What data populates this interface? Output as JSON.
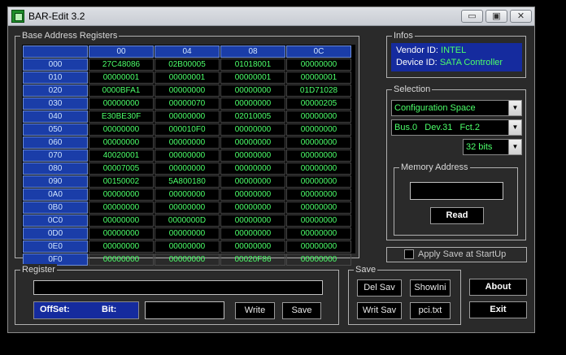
{
  "window": {
    "title": "BAR-Edit 3.2"
  },
  "titlebar": {
    "min_glyph": "▭",
    "max_glyph": "▣",
    "close_glyph": "✕"
  },
  "bar_group": {
    "label": "Base Address Registers",
    "columns": [
      "00",
      "04",
      "08",
      "0C"
    ],
    "rows": [
      {
        "addr": "000",
        "cells": [
          "27C48086",
          "02B00005",
          "01018001",
          "00000000"
        ]
      },
      {
        "addr": "010",
        "cells": [
          "00000001",
          "00000001",
          "00000001",
          "00000001"
        ]
      },
      {
        "addr": "020",
        "cells": [
          "0000BFA1",
          "00000000",
          "00000000",
          "01D71028"
        ]
      },
      {
        "addr": "030",
        "cells": [
          "00000000",
          "00000070",
          "00000000",
          "00000205"
        ]
      },
      {
        "addr": "040",
        "cells": [
          "E30BE30F",
          "00000000",
          "02010005",
          "00000000"
        ]
      },
      {
        "addr": "050",
        "cells": [
          "00000000",
          "000010F0",
          "00000000",
          "00000000"
        ]
      },
      {
        "addr": "060",
        "cells": [
          "00000000",
          "00000000",
          "00000000",
          "00000000"
        ]
      },
      {
        "addr": "070",
        "cells": [
          "40020001",
          "00000000",
          "00000000",
          "00000000"
        ]
      },
      {
        "addr": "080",
        "cells": [
          "00007005",
          "00000000",
          "00000000",
          "00000000"
        ]
      },
      {
        "addr": "090",
        "cells": [
          "00150002",
          "5A800180",
          "00000000",
          "00000000"
        ]
      },
      {
        "addr": "0A0",
        "cells": [
          "00000000",
          "00000000",
          "00000000",
          "00000000"
        ]
      },
      {
        "addr": "0B0",
        "cells": [
          "00000000",
          "00000000",
          "00000000",
          "00000000"
        ]
      },
      {
        "addr": "0C0",
        "cells": [
          "00000000",
          "0000000D",
          "00000000",
          "00000000"
        ]
      },
      {
        "addr": "0D0",
        "cells": [
          "00000000",
          "00000000",
          "00000000",
          "00000000"
        ]
      },
      {
        "addr": "0E0",
        "cells": [
          "00000000",
          "00000000",
          "00000000",
          "00000000"
        ]
      },
      {
        "addr": "0F0",
        "cells": [
          "00000000",
          "00000000",
          "00020F86",
          "00000000"
        ]
      }
    ]
  },
  "infos": {
    "label": "Infos",
    "vendor_label": "Vendor ID:",
    "vendor_value": "INTEL",
    "device_label": "Device ID:",
    "device_value": "SATA Controller"
  },
  "selection": {
    "label": "Selection",
    "space": "Configuration Space",
    "bdf": "Bus.0   Dev.31   Fct.2",
    "width": "32 bits",
    "memory_label": "Memory Address",
    "memory_value": "",
    "read_label": "Read"
  },
  "apply": {
    "label": "Apply Save at StartUp",
    "checked": false
  },
  "register": {
    "label": "Register",
    "value": "",
    "offset_label": "OffSet:",
    "bit_label": "Bit:",
    "bit_value": "",
    "write_label": "Write",
    "save_label": "Save"
  },
  "save_group": {
    "label": "Save",
    "del_label": "Del Sav",
    "showini_label": "ShowIni",
    "writ_label": "Writ Sav",
    "pci_label": "pci.txt"
  },
  "about_label": "About",
  "exit_label": "Exit",
  "colors": {
    "accent_blue": "#1a3da8",
    "value_green": "#4cff6a",
    "panel": "#2a2a2a"
  }
}
